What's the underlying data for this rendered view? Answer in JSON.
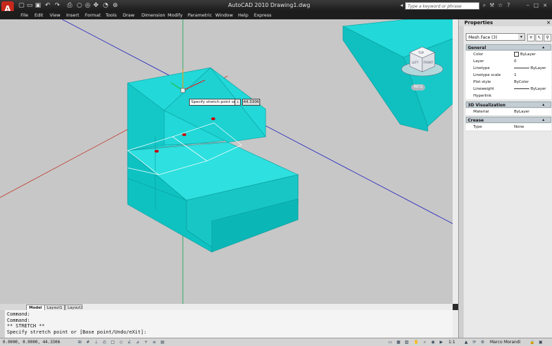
{
  "app": {
    "title": "AutoCAD 2010    Drawing1.dwg",
    "logo_letter": "A",
    "search_placeholder": "Type a keyword or phrase"
  },
  "quick_access": [
    "new-icon",
    "open-icon",
    "save-icon",
    "undo-icon",
    "redo-icon",
    "plot-icon"
  ],
  "menus": [
    "File",
    "Edit",
    "View",
    "Insert",
    "Format",
    "Tools",
    "Draw",
    "Dimension",
    "Modify",
    "Parametric",
    "Window",
    "Help",
    "Express"
  ],
  "viewport": {
    "tooltip": "Specify stretch point or",
    "tooltip_value": "44.3306",
    "viewcube_faces": [
      "TOP",
      "LEFT",
      "FRONT"
    ],
    "ucs_label": "WCS",
    "colors": {
      "background": "#c7c7c7",
      "solid": "#00cccc"
    }
  },
  "properties": {
    "title": "Properties",
    "close_glyph": "×",
    "selection": "Mesh Face (3)",
    "sections": [
      {
        "name": "General",
        "rows": [
          {
            "label": "Color",
            "value": "ByLayer",
            "swatch": true
          },
          {
            "label": "Layer",
            "value": "0"
          },
          {
            "label": "Linetype",
            "value": "ByLayer",
            "line": true
          },
          {
            "label": "Linetype scale",
            "value": "1"
          },
          {
            "label": "Plot style",
            "value": "ByColor"
          },
          {
            "label": "Lineweight",
            "value": "ByLayer",
            "line": true
          },
          {
            "label": "Hyperlink",
            "value": ""
          }
        ]
      },
      {
        "name": "3D Visualization",
        "rows": [
          {
            "label": "Material",
            "value": "ByLayer"
          }
        ]
      },
      {
        "name": "Crease",
        "rows": [
          {
            "label": "Type",
            "value": "None"
          }
        ]
      }
    ]
  },
  "tabs": [
    "Model",
    "Layout1",
    "Layout2"
  ],
  "command_history": [
    "Command:",
    "Command:",
    "** STRETCH **",
    "Specify stretch point or [Base point/Undo/eXit]:"
  ],
  "status": {
    "coordinates": "0.0000, 0.0000, 44.3306",
    "scale": "1:1",
    "user": "Marco Morandi"
  }
}
